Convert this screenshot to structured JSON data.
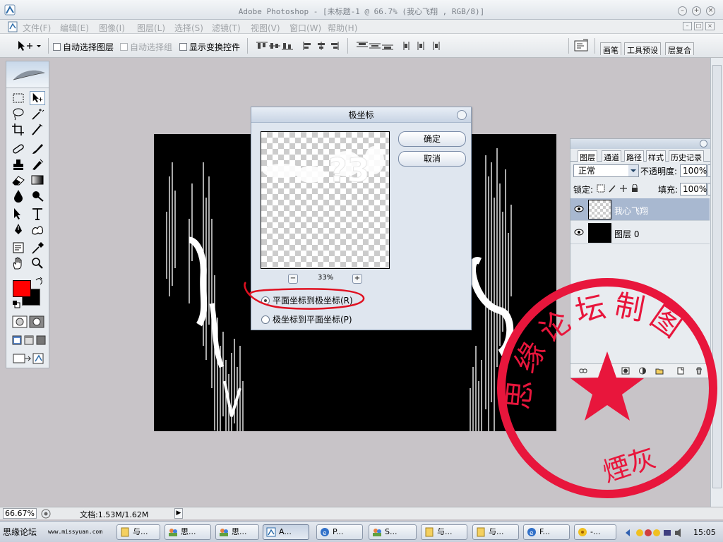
{
  "window": {
    "title": "Adobe Photoshop - [未标题-1 @ 66.7% (我心飞翔 , RGB/8)]"
  },
  "menu": {
    "items": [
      "文件(F)",
      "编辑(E)",
      "图像(I)",
      "图层(L)",
      "选择(S)",
      "滤镜(T)",
      "视图(V)",
      "窗口(W)",
      "帮助(H)"
    ]
  },
  "options": {
    "auto_select_layer": "自动选择图层",
    "auto_select_group": "自动选择组",
    "show_transform": "显示变换控件",
    "palette_tabs": [
      "画笔",
      "工具预设",
      "层复合"
    ]
  },
  "dialog": {
    "title": "极坐标",
    "ok": "确定",
    "cancel": "取消",
    "zoom": "33%",
    "zoom_minus": "−",
    "zoom_plus": "+",
    "options": [
      {
        "label": "平面坐标到极坐标(R)",
        "selected": true
      },
      {
        "label": "极坐标到平面坐标(P)",
        "selected": false
      }
    ],
    "preview_text": "?3"
  },
  "layers_panel": {
    "tabs": [
      "图层",
      "通道",
      "路径",
      "样式",
      "历史记录"
    ],
    "blend_mode": "正常",
    "opacity_label": "不透明度:",
    "opacity": "100%",
    "lock_label": "锁定:",
    "fill_label": "填充:",
    "fill": "100%",
    "layers": [
      {
        "name": "我心飞翔",
        "selected": true,
        "visible": true
      },
      {
        "name": "图层 0",
        "selected": false,
        "visible": true
      }
    ]
  },
  "status": {
    "zoom": "66.67%",
    "doc": "文档:1.53M/1.62M"
  },
  "taskbar": {
    "start": "思缘论坛",
    "url": "www.missyuan.com",
    "buttons": [
      "与...",
      "思...",
      "思...",
      "A...",
      "P...",
      "S...",
      "与...",
      "与...",
      "F...",
      "-..."
    ],
    "clock": "15:05"
  },
  "stamp": {
    "arc_text": "思缘论坛制图",
    "signature": "煙灰"
  },
  "colors": {
    "foreground": "#ff0000",
    "background": "#000000",
    "stamp_red": "#e8163c",
    "annotation_red": "#e01020"
  }
}
